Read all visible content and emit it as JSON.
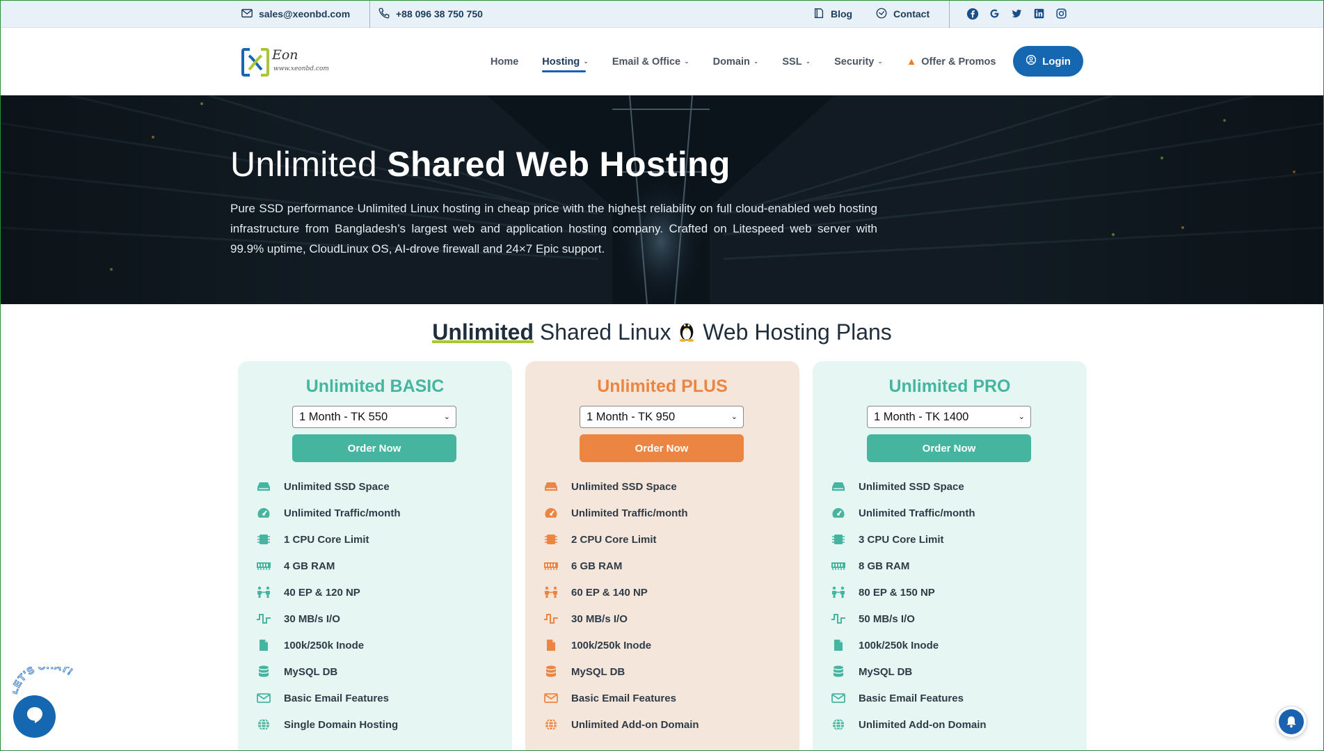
{
  "topbar": {
    "email": "sales@xeonbd.com",
    "phone": "+88 096 38 750 750",
    "blog": "Blog",
    "contact": "Contact",
    "social_icons": [
      "facebook-icon",
      "google-icon",
      "twitter-icon",
      "linkedin-icon",
      "instagram-icon"
    ]
  },
  "header": {
    "logo_text": "Eon",
    "logo_url": "www.xeonbd.com",
    "nav": [
      "Home",
      "Hosting",
      "Email & Office",
      "Domain",
      "SSL",
      "Security",
      "Offer & Promos"
    ],
    "active_nav": "Hosting",
    "login": "Login"
  },
  "hero": {
    "title_light": "Unlimited",
    "title_bold": "Shared Web Hosting",
    "description": "Pure SSD performance Unlimited Linux hosting in cheap price with the highest reliability on full cloud-enabled web hosting infrastructure from Bangladesh’s largest web and application hosting company. Crafted on Litespeed web server with 99.9% uptime, CloudLinux OS, AI-drove firewall and 24×7 Epic support."
  },
  "section": {
    "title_bold": "Unlimited",
    "title_rest_1": "Shared Linux",
    "title_rest_2": "Web Hosting Plans"
  },
  "plans": [
    {
      "name": "Unlimited BASIC",
      "select": "1 Month - TK 550",
      "order": "Order Now",
      "features": [
        "Unlimited SSD Space",
        "Unlimited Traffic/month",
        "1 CPU Core Limit",
        "4 GB RAM",
        "40 EP & 120 NP",
        "30 MB/s I/O",
        "100k/250k Inode",
        "MySQL DB",
        "Basic Email Features",
        "Single Domain Hosting"
      ]
    },
    {
      "name": "Unlimited PLUS",
      "select": "1 Month - TK 950",
      "order": "Order Now",
      "features": [
        "Unlimited SSD Space",
        "Unlimited Traffic/month",
        "2 CPU Core Limit",
        "6 GB RAM",
        "60 EP & 140 NP",
        "30 MB/s I/O",
        "100k/250k Inode",
        "MySQL DB",
        "Basic Email Features",
        "Unlimited Add-on Domain"
      ]
    },
    {
      "name": "Unlimited PRO",
      "select": "1 Month - TK 1400",
      "order": "Order Now",
      "features": [
        "Unlimited SSD Space",
        "Unlimited Traffic/month",
        "3 CPU Core Limit",
        "8 GB RAM",
        "80 EP & 150 NP",
        "50 MB/s I/O",
        "100k/250k Inode",
        "MySQL DB",
        "Basic Email Features",
        "Unlimited Add-on Domain"
      ]
    }
  ],
  "chat": {
    "label": "LET'S CHAT!"
  },
  "colors": {
    "teal": "#45b5a0",
    "orange": "#ec8541",
    "brand_blue": "#1467b0",
    "lime": "#a8c636"
  }
}
